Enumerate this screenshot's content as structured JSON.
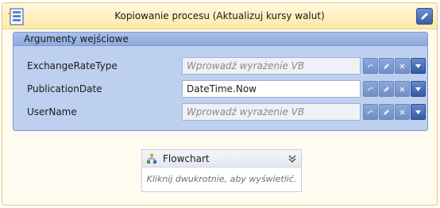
{
  "activity": {
    "title": "Kopiowanie procesu (Aktualizuj kursy walut)",
    "icon": "sequence-activity-icon",
    "edit_icon": "pencil-icon"
  },
  "arguments": {
    "header": "Argumenty wejściowe",
    "rows": [
      {
        "name": "ExchangeRateType",
        "value": "",
        "placeholder": "Wprowadź wyrażenie VB"
      },
      {
        "name": "PublicationDate",
        "value": "DateTime.Now",
        "placeholder": ""
      },
      {
        "name": "UserName",
        "value": "",
        "placeholder": "Wprowadź wyrażenie VB"
      }
    ],
    "row_buttons": [
      "link-icon",
      "edit-icon",
      "clear-icon",
      "dropdown-arrow-icon"
    ]
  },
  "flowchart": {
    "title": "Flowchart",
    "hint": "Kliknij dwukrotnie, aby wyświetlić.",
    "icon": "flowchart-icon",
    "toggle_icon": "double-chevron-down-icon"
  },
  "colors": {
    "activity_header": "#ffe9a6",
    "activity_border": "#e3c975",
    "args_panel": "#bdd0ef",
    "button_blue": "#3a5ca6"
  }
}
